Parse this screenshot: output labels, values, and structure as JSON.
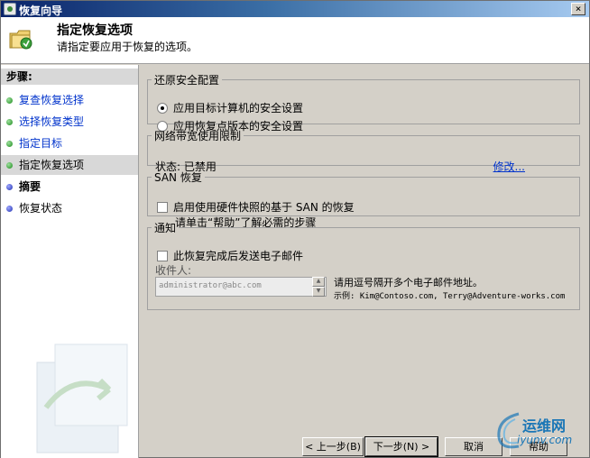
{
  "window": {
    "title": "恢复向导",
    "close_glyph": "×"
  },
  "header": {
    "title": "指定恢复选项",
    "subtitle": "请指定要应用于恢复的选项。"
  },
  "steps": {
    "title": "步骤:",
    "items": [
      {
        "label": "复查恢复选择",
        "state": "done"
      },
      {
        "label": "选择恢复类型",
        "state": "done"
      },
      {
        "label": "指定目标",
        "state": "done"
      },
      {
        "label": "指定恢复选项",
        "state": "current"
      },
      {
        "label": "摘要",
        "state": "pending"
      },
      {
        "label": "恢复状态",
        "state": "pending"
      }
    ]
  },
  "security": {
    "legend": "还原安全配置",
    "option1": "应用目标计算机的安全设置",
    "option2": "应用恢复点版本的安全设置",
    "selected": 1
  },
  "bandwidth": {
    "legend": "网络带宽使用限制",
    "status": "状态: 已禁用",
    "change_link": "修改..."
  },
  "san": {
    "legend": "SAN 恢复",
    "checkbox_label": "启用使用硬件快照的基于 SAN 的恢复",
    "hint": "请单击“帮助”了解必需的步骤",
    "checked": false
  },
  "notify": {
    "legend": "通知",
    "checkbox_label": "此恢复完成后发送电子邮件",
    "checked": false,
    "recipients_label": "收件人:",
    "recipients_value": "administrator@abc.com",
    "note": "请用逗号隔开多个电子邮件地址。",
    "example": "示例: Kim@Contoso.com, Terry@Adventure-works.com"
  },
  "buttons": {
    "back": "< 上一步(B)",
    "next": "下一步(N) >",
    "cancel": "取消",
    "help": "帮助"
  },
  "watermark": {
    "line1": "运维网",
    "line2": "iyunv.com"
  },
  "colors": {
    "link": "#0033cc",
    "done_dot": "#1a8a1a",
    "pending_dot": "#2030b0",
    "titlebar": "#0a246a"
  }
}
